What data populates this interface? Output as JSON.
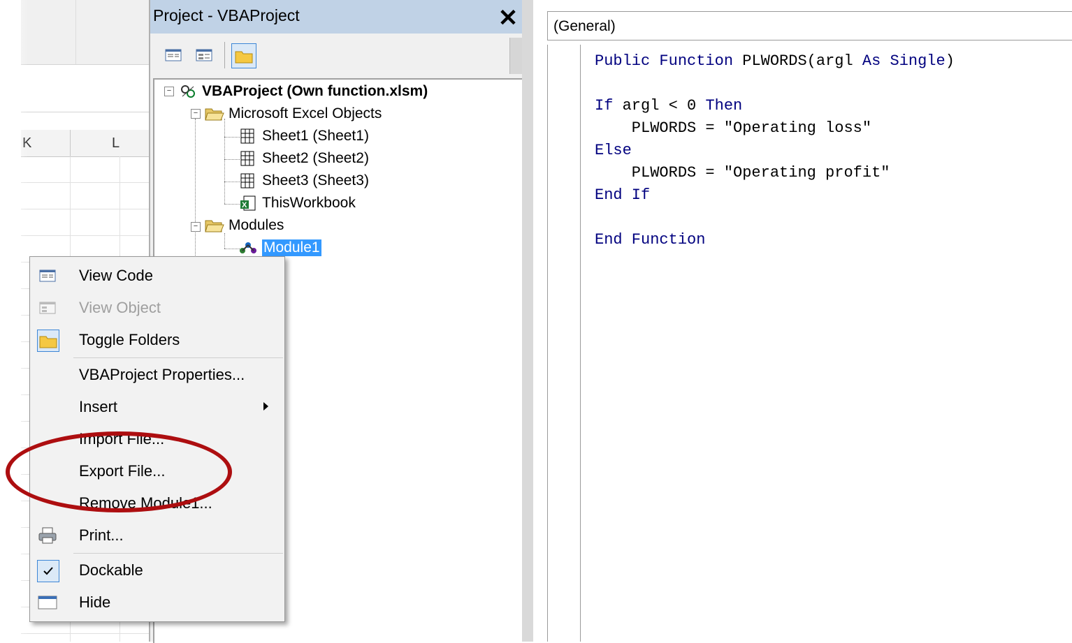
{
  "colors": {
    "title_bar": "#c0d2e6",
    "selection": "#3399ff",
    "vba_keyword": "#00007f",
    "annotation_ellipse": "#ad0e10"
  },
  "excel": {
    "columns": [
      "K",
      "L"
    ]
  },
  "project_explorer": {
    "title": "Project - VBAProject",
    "close_icon": "close-icon",
    "toolbar": {
      "buttons": [
        {
          "name": "view-code-icon",
          "active": false
        },
        {
          "name": "view-object-icon",
          "active": false
        },
        {
          "name": "toggle-folders-icon",
          "active": true
        }
      ]
    },
    "tree": {
      "root": "VBAProject (Own function.xlsm)",
      "excel_objects_folder": "Microsoft Excel Objects",
      "sheets": [
        "Sheet1 (Sheet1)",
        "Sheet2 (Sheet2)",
        "Sheet3 (Sheet3)"
      ],
      "workbook": "ThisWorkbook",
      "modules_folder": "Modules",
      "module": "Module1"
    }
  },
  "code_window": {
    "object_dropdown": "(General)",
    "lines": [
      "Public Function PLWORDS(argl As Single)",
      "",
      "If argl < 0 Then",
      "    PLWORDS = \"Operating loss\"",
      "Else",
      "    PLWORDS = \"Operating profit\"",
      "End If",
      "",
      "End Function"
    ]
  },
  "context_menu": {
    "items": [
      {
        "label": "View Code",
        "icon": "view-code-icon",
        "disabled": false
      },
      {
        "label": "View Object",
        "icon": "view-object-icon",
        "disabled": true
      },
      {
        "label": "Toggle Folders",
        "icon": "folder-icon",
        "disabled": false
      },
      {
        "label": "VBAProject Properties...",
        "icon": "",
        "disabled": false
      },
      {
        "label": "Insert",
        "icon": "",
        "disabled": false,
        "submenu": true
      },
      {
        "label": "Import File...",
        "icon": "",
        "disabled": false
      },
      {
        "label": "Export File...",
        "icon": "",
        "disabled": false
      },
      {
        "label": "Remove Module1...",
        "icon": "",
        "disabled": false
      },
      {
        "label": "Print...",
        "icon": "printer-icon",
        "disabled": false
      },
      {
        "label": "Dockable",
        "icon": "checkmark-icon",
        "disabled": false,
        "checked": true
      },
      {
        "label": "Hide",
        "icon": "window-icon",
        "disabled": false
      }
    ]
  }
}
